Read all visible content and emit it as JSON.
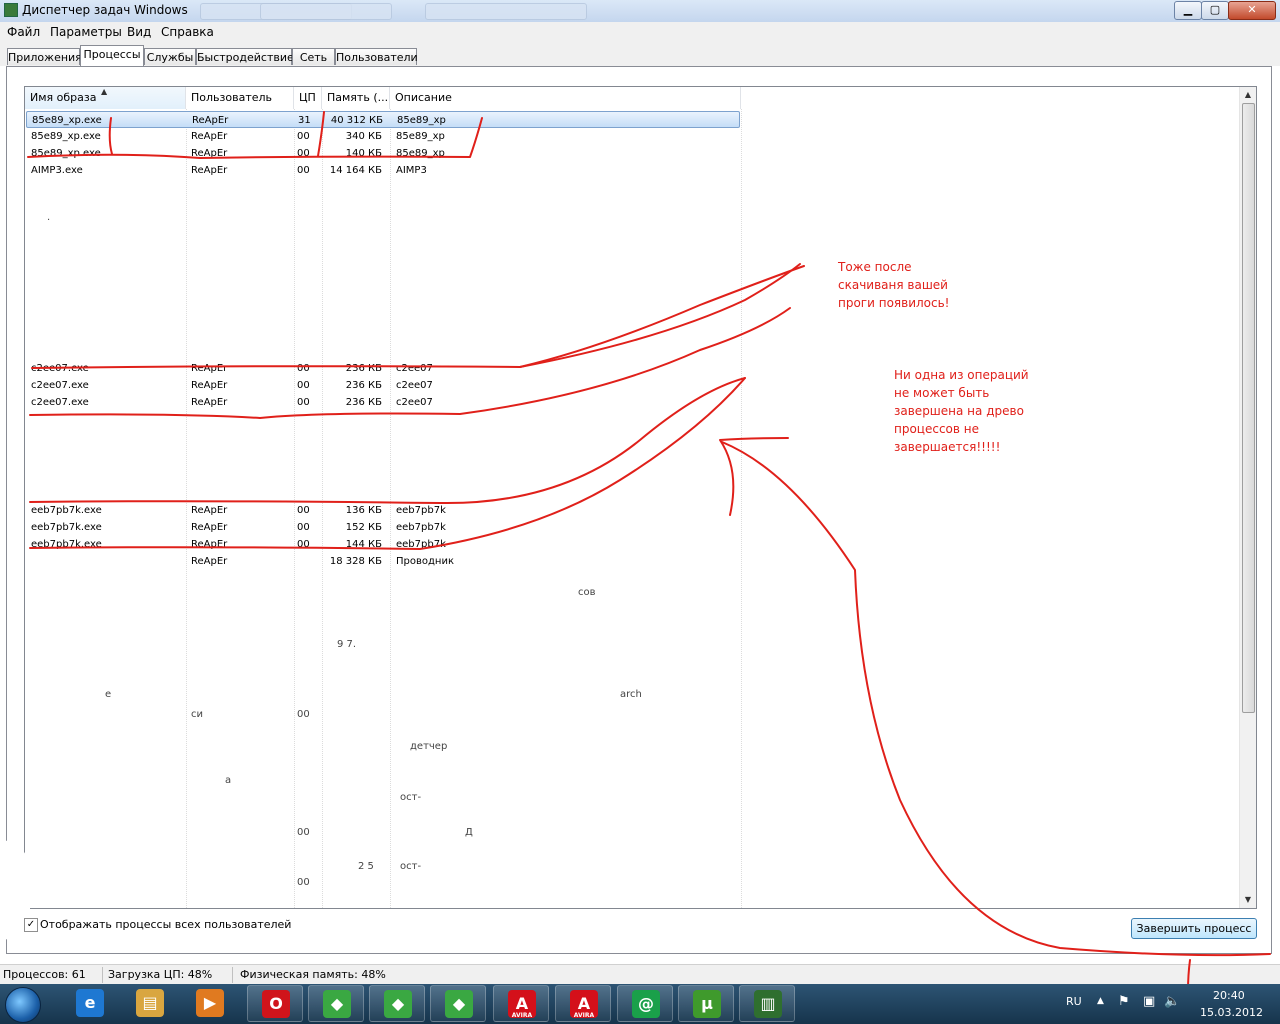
{
  "window": {
    "title": "Диспетчер задач Windows"
  },
  "menu": [
    "Файл",
    "Параметры",
    "Вид",
    "Справка"
  ],
  "tabs": [
    "Приложения",
    "Процессы",
    "Службы",
    "Быстродействие",
    "Сеть",
    "Пользователи"
  ],
  "active_tab": "Процессы",
  "columns": [
    "Имя образа",
    "Пользователь",
    "ЦП",
    "Память (...",
    "Описание"
  ],
  "rows": [
    {
      "name": "85e89_xp.exe",
      "user": "ReApEr",
      "cpu": "31",
      "mem": "40 312 КБ",
      "desc": "85e89_xp",
      "selected": true
    },
    {
      "name": "85e89_xp.exe",
      "user": "ReApEr",
      "cpu": "00",
      "mem": "340 КБ",
      "desc": "85e89_xp"
    },
    {
      "name": "85e89_xp.exe",
      "user": "ReApEr",
      "cpu": "00",
      "mem": "140 КБ",
      "desc": "85e89_xp"
    },
    {
      "name": "AIMP3.exe",
      "user": "ReApEr",
      "cpu": "00",
      "mem": "14 164 КБ",
      "desc": "AIMP3"
    },
    {
      "name": "c2ee07.exe",
      "user": "ReApEr",
      "cpu": "00",
      "mem": "236 КБ",
      "desc": "c2ee07"
    },
    {
      "name": "c2ee07.exe",
      "user": "ReApEr",
      "cpu": "00",
      "mem": "236 КБ",
      "desc": "c2ee07"
    },
    {
      "name": "c2ee07.exe",
      "user": "ReApEr",
      "cpu": "00",
      "mem": "236 КБ",
      "desc": "c2ee07"
    },
    {
      "name": "eeb7pb7k.exe",
      "user": "ReApEr",
      "cpu": "00",
      "mem": "136 КБ",
      "desc": "eeb7pb7k"
    },
    {
      "name": "eeb7pb7k.exe",
      "user": "ReApEr",
      "cpu": "00",
      "mem": "152 КБ",
      "desc": "eeb7pb7k"
    },
    {
      "name": "eeb7pb7k.exe",
      "user": "ReApEr",
      "cpu": "00",
      "mem": "144 КБ",
      "desc": "eeb7pb7k"
    },
    {
      "name": "",
      "user": "ReApEr",
      "cpu": "",
      "mem": "18 328 КБ",
      "desc": "Проводник"
    }
  ],
  "show_all_users_label": "Отображать процессы всех пользователей",
  "show_all_users_checked": true,
  "end_process_label": "Завершить процесс",
  "status": {
    "processes": "Процессов: 61",
    "cpu": "Загрузка ЦП: 48%",
    "memory": "Физическая память: 48%"
  },
  "annotations": {
    "note1": "Тоже после\nскачиваня вашей\nпроги появилось!",
    "note2": "Ни одна из операций\nне может быть\nзавершена на древо\nпроцессов не\nзавершается!!!!!"
  },
  "taskbar": {
    "apps": [
      {
        "icon": "internet-explorer-icon",
        "glyph": "e",
        "color": "#1e78d2"
      },
      {
        "icon": "explorer-folder-icon",
        "glyph": "▤",
        "color": "#d9a640"
      },
      {
        "icon": "media-player-icon",
        "glyph": "▶",
        "color": "#e07a20"
      },
      {
        "icon": "opera-icon",
        "glyph": "O",
        "color": "#d0141b"
      },
      {
        "icon": "kaspersky-icon",
        "glyph": "◆",
        "color": "#3aa842"
      },
      {
        "icon": "kaspersky-icon",
        "glyph": "◆",
        "color": "#3aa842"
      },
      {
        "icon": "kaspersky-icon",
        "glyph": "◆",
        "color": "#3aa842"
      },
      {
        "icon": "avira-icon",
        "glyph": "A",
        "color": "#d4101a",
        "label": "AVIRA"
      },
      {
        "icon": "avira-icon",
        "glyph": "A",
        "color": "#d4101a",
        "label": "AVIRA"
      },
      {
        "icon": "mail-agent-icon",
        "glyph": "@",
        "color": "#1aa04a"
      },
      {
        "icon": "utorrent-icon",
        "glyph": "µ",
        "color": "#3f9a2c"
      },
      {
        "icon": "task-manager-icon",
        "glyph": "▥",
        "color": "#2f6f2f"
      }
    ],
    "lang": "RU",
    "time": "20:40",
    "date": "15.03.2012"
  },
  "accent_red": "#e0201a"
}
